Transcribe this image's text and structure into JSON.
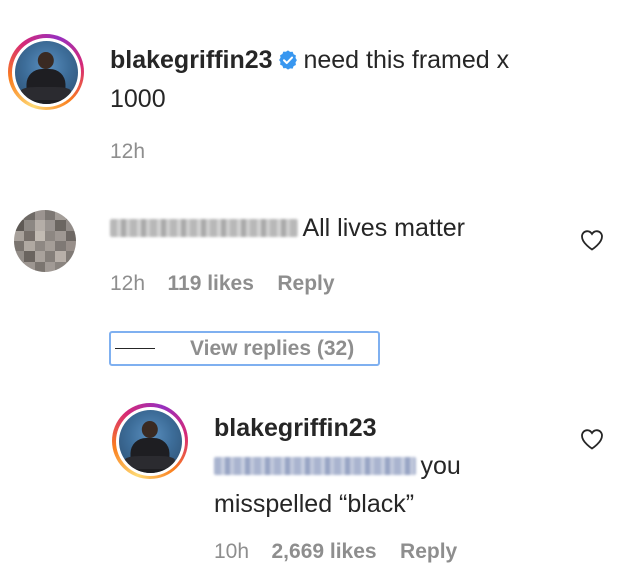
{
  "post_caption": {
    "username": "blakegriffin23",
    "verified": true,
    "text": "need this framed x",
    "text_line2": "1000",
    "time": "12h"
  },
  "comment": {
    "username_obscured": true,
    "text": "All lives matter",
    "time": "12h",
    "likes": "119 likes",
    "reply_label": "Reply",
    "view_replies_label": "View replies (32)"
  },
  "reply": {
    "username": "blakegriffin23",
    "mention_obscured": true,
    "text_line1": "you",
    "text_line2": "misspelled “black”",
    "time": "10h",
    "likes": "2,669 likes",
    "reply_label": "Reply"
  },
  "icons": {
    "verified": "verified-badge-icon",
    "heart": "heart-outline-icon"
  },
  "colors": {
    "verified_blue": "#3897f0",
    "meta_gray": "#8e8e8e",
    "view_replies_outline": "#7fb0f0"
  }
}
